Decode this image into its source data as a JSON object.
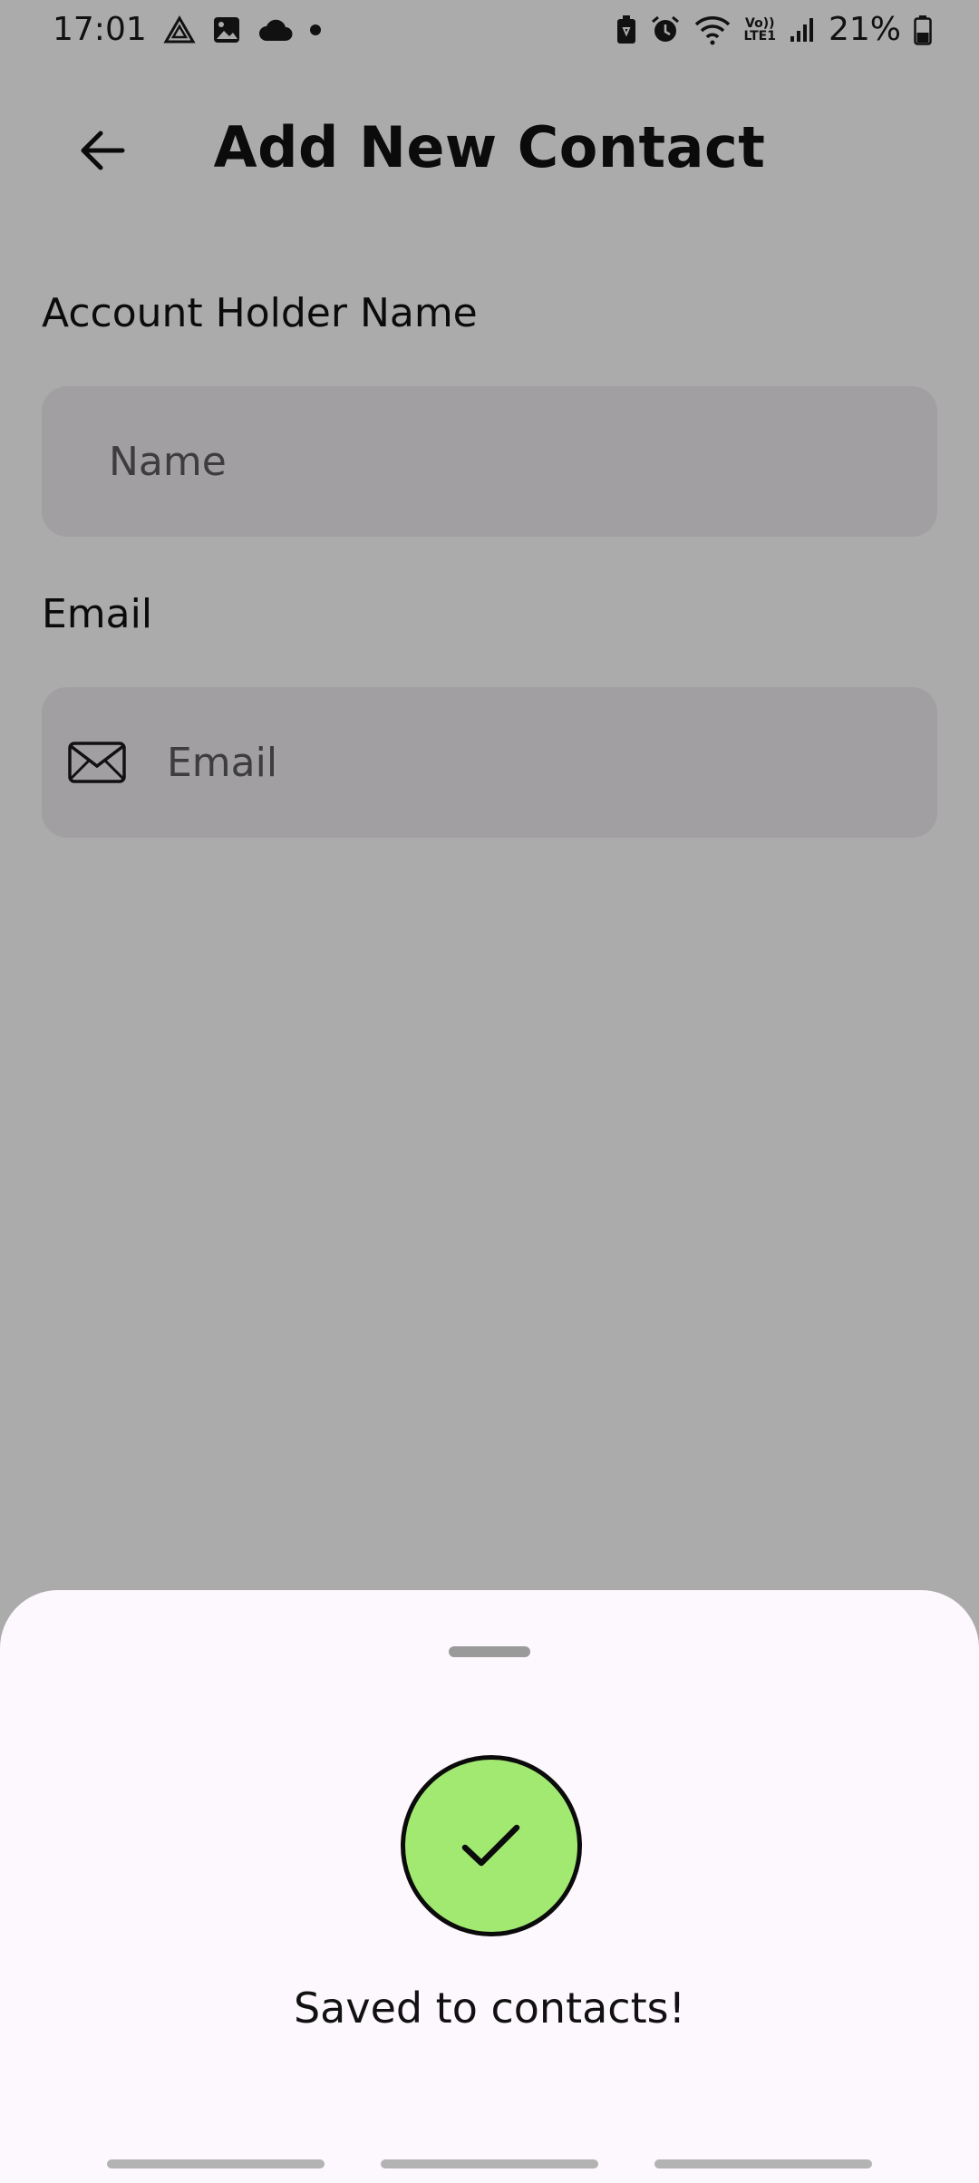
{
  "status_bar": {
    "time": "17:01",
    "battery_text": "21%",
    "left_icons": [
      "drive-icon",
      "image-icon",
      "cloud-icon",
      "dot"
    ],
    "right_icons": [
      "battery-saver-icon",
      "alarm-icon",
      "wifi-icon",
      "volte-icon",
      "signal-icon",
      "battery-icon"
    ],
    "volte_text_top": "Vo))",
    "volte_text_bottom": "LTE1"
  },
  "app_bar": {
    "title": "Add New Contact",
    "back_icon": "arrow-left-icon"
  },
  "form": {
    "name_label": "Account Holder Name",
    "name_placeholder": "Name",
    "name_value": "",
    "email_label": "Email",
    "email_placeholder": "Email",
    "email_value": "",
    "email_icon": "mail-icon"
  },
  "sheet": {
    "message": "Saved to contacts!",
    "icon": "check-icon",
    "accent_color": "#a2e972"
  },
  "colors": {
    "field_bg": "#f1edf2",
    "sheet_bg": "#fdf8fd",
    "scrim": "rgba(0,0,0,0.33)"
  }
}
